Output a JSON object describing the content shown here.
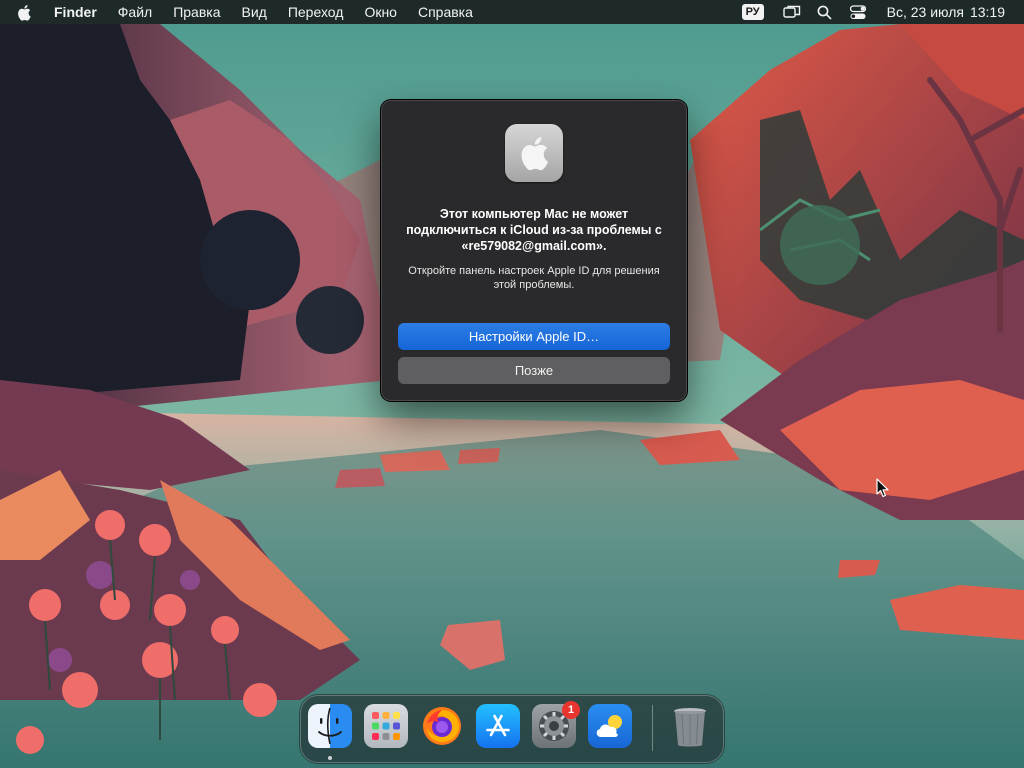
{
  "menubar": {
    "app_name": "Finder",
    "items": [
      "Файл",
      "Правка",
      "Вид",
      "Переход",
      "Окно",
      "Справка"
    ],
    "input_language": "РУ",
    "date": "Вс, 23 июля",
    "time": "13:19",
    "status_icons": [
      "screen-mirroring-icon",
      "spotlight-search-icon",
      "control-center-icon"
    ]
  },
  "dialog": {
    "icon": "system-settings-apple-icon",
    "title": "Этот компьютер Mac не может подключиться к iCloud из-за проблемы с «re579082@gmail.com».",
    "message": "Откройте панель настроек Apple ID для решения этой проблемы.",
    "primary_button": "Настройки Apple ID…",
    "secondary_button": "Позже"
  },
  "dock": {
    "apps": [
      {
        "name": "Finder",
        "icon": "finder-icon",
        "running": true
      },
      {
        "name": "Launchpad",
        "icon": "launchpad-icon",
        "running": false
      },
      {
        "name": "Firefox",
        "icon": "firefox-icon",
        "running": false
      },
      {
        "name": "App Store",
        "icon": "app-store-icon",
        "running": false
      },
      {
        "name": "System Settings",
        "icon": "system-settings-icon",
        "running": false,
        "badge": "1"
      },
      {
        "name": "Weather",
        "icon": "weather-icon",
        "running": false
      }
    ],
    "trash": {
      "name": "Trash",
      "icon": "trash-icon"
    }
  },
  "colors": {
    "menubar_bg": "#1b1d1f",
    "dialog_bg": "#2a2a2c",
    "primary_button": "#1a6fe0",
    "secondary_button": "#5f5f61",
    "badge": "#e8352f"
  }
}
